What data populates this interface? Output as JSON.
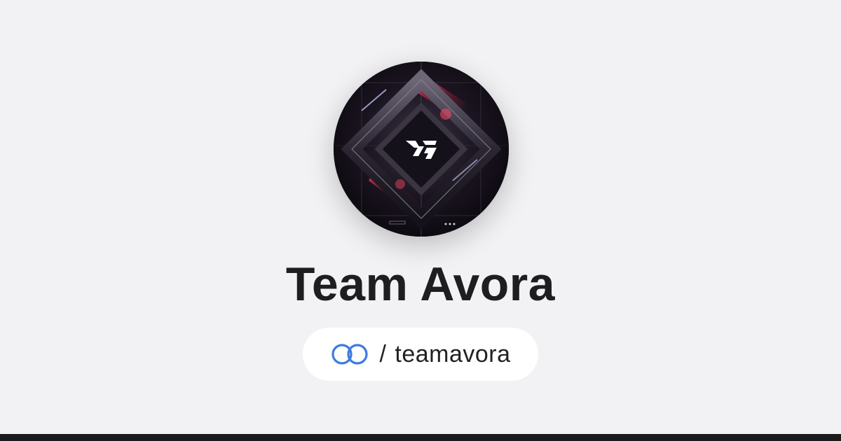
{
  "profile": {
    "name": "Team Avora",
    "avatar_icon": "team-avora-logo",
    "handle_separator": "/",
    "handle": "teamavora",
    "link_icon": "linked-rings-icon"
  },
  "colors": {
    "background": "#f2f2f4",
    "title": "#1e1e20",
    "pill_background": "#ffffff",
    "link_icon": "#3d7be0",
    "bottom_bar": "#1a1a1c",
    "avatar_accent": "#e0304a"
  }
}
